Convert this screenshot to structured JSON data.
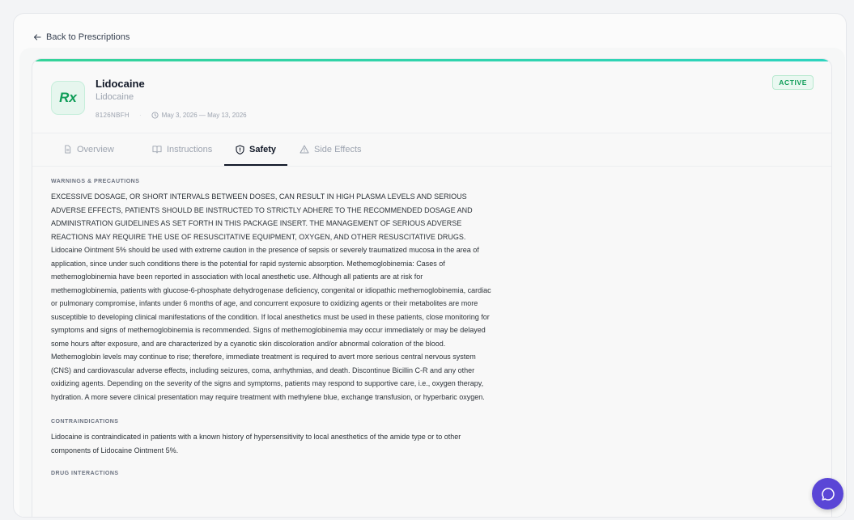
{
  "nav": {
    "back_label": "Back to Prescriptions"
  },
  "prescription": {
    "icon_label": "Rx",
    "name": "Lidocaine",
    "generic": "Lidocaine",
    "code": "8126NBFH",
    "dates": "May 3, 2026 — May 13, 2026",
    "status": "ACTIVE"
  },
  "tabs": [
    {
      "label": "Overview",
      "icon": "document-icon"
    },
    {
      "label": "Instructions",
      "icon": "book-icon"
    },
    {
      "label": "Safety",
      "icon": "shield-icon",
      "active": true
    },
    {
      "label": "Side Effects",
      "icon": "warning-icon"
    }
  ],
  "sections": {
    "warnings": {
      "title": "WARNINGS & PRECAUTIONS",
      "body": "EXCESSIVE DOSAGE, OR SHORT INTERVALS BETWEEN DOSES, CAN RESULT IN HIGH PLASMA LEVELS AND SERIOUS ADVERSE EFFECTS, PATIENTS SHOULD BE INSTRUCTED TO STRICTLY ADHERE TO THE RECOMMENDED DOSAGE AND ADMINISTRATION GUIDELINES AS SET FORTH IN THIS PACKAGE INSERT. THE MANAGEMENT OF SERIOUS ADVERSE REACTIONS MAY REQUIRE THE USE OF RESUSCITATIVE EQUIPMENT, OXYGEN, AND OTHER RESUSCITATIVE DRUGS. Lidocaine Ointment 5% should be used with extreme caution in the presence of sepsis or severely traumatized mucosa in the area of application, since under such conditions there is the potential for rapid systemic absorption. Methemoglobinemia: Cases of methemoglobinemia have been reported in association with local anesthetic use. Although all patients are at risk for methemoglobinemia, patients with glucose-6-phosphate dehydrogenase deficiency, congenital or idiopathic methemoglobinemia, cardiac or pulmonary compromise, infants under 6 months of age, and concurrent exposure to oxidizing agents or their metabolites are more susceptible to developing clinical manifestations of the condition. If local anesthetics must be used in these patients, close monitoring for symptoms and signs of methemoglobinemia is recommended. Signs of methemoglobinemia may occur immediately or may be delayed some hours after exposure, and are characterized by a cyanotic skin discoloration and/or abnormal coloration of the blood. Methemoglobin levels may continue to rise; therefore, immediate treatment is required to avert more serious central nervous system (CNS) and cardiovascular adverse effects, including seizures, coma, arrhythmias, and death. Discontinue Bicillin C-R and any other oxidizing agents. Depending on the severity of the signs and symptoms, patients may respond to supportive care, i.e., oxygen therapy, hydration. A more severe clinical presentation may require treatment with methylene blue, exchange transfusion, or hyperbaric oxygen."
    },
    "contraindications": {
      "title": "CONTRAINDICATIONS",
      "body": "Lidocaine is contraindicated in patients with a known history of hypersensitivity to local anesthetics of the amide type or to other components of Lidocaine Ointment 5%."
    },
    "interactions": {
      "title": "DRUG INTERACTIONS"
    }
  },
  "colors": {
    "accent": "#10b981",
    "status_green": "#0f9d58",
    "chat_button": "#5a46d6"
  }
}
